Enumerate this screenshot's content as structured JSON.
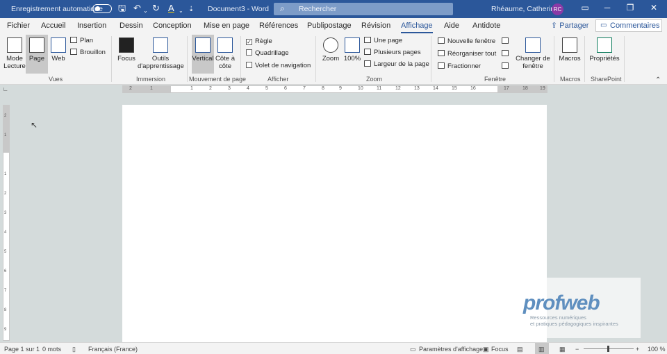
{
  "titlebar": {
    "autosave_label": "Enregistrement automatique",
    "doc_title": "Document3  -  Word",
    "search_placeholder": "Rechercher",
    "user_name": "Rhéaume, Catherine",
    "user_initials": "RC",
    "icons": [
      "save-icon",
      "undo-icon",
      "redo-icon",
      "font-color-icon",
      "minimize-icon",
      "restore-icon",
      "close-icon"
    ]
  },
  "tabs": [
    "Fichier",
    "Accueil",
    "Insertion",
    "Dessin",
    "Conception",
    "Mise en page",
    "Références",
    "Publipostage",
    "Révision",
    "Affichage",
    "Aide",
    "Antidote"
  ],
  "active_tab": "Affichage",
  "share_label": "Partager",
  "comments_label": "Commentaires",
  "ribbon": {
    "vues": {
      "label": "Vues",
      "mode_lecture": "Mode Lecture",
      "page": "Page",
      "web": "Web",
      "plan": "Plan",
      "brouillon": "Brouillon"
    },
    "immersion": {
      "label": "Immersion",
      "focus": "Focus",
      "outils": "Outils d'apprentissage"
    },
    "mouvement": {
      "label": "Mouvement de page",
      "vertical": "Vertical",
      "cote": "Côte à côte"
    },
    "afficher": {
      "label": "Afficher",
      "regle": "Règle",
      "regle_checked": true,
      "quadrillage": "Quadrillage",
      "volet": "Volet de navigation"
    },
    "zoom": {
      "label": "Zoom",
      "zoom": "Zoom",
      "pct": "100%",
      "une_page": "Une page",
      "plusieurs": "Plusieurs pages",
      "largeur": "Largeur de la page"
    },
    "fenetre": {
      "label": "Fenêtre",
      "nouvelle": "Nouvelle fenêtre",
      "reorganiser": "Réorganiser tout",
      "fractionner": "Fractionner",
      "changer": "Changer de fenêtre"
    },
    "macros": {
      "label": "Macros",
      "macros": "Macros"
    },
    "sharepoint": {
      "label": "SharePoint",
      "proprietes": "Propriétés"
    }
  },
  "ruler": {
    "h_ticks": [
      "2",
      "1",
      "1",
      "2",
      "3",
      "4",
      "5",
      "6",
      "7",
      "8",
      "9",
      "10",
      "11",
      "12",
      "13",
      "14",
      "15",
      "16",
      "17",
      "18",
      "19"
    ],
    "v_ticks": [
      "2",
      "1",
      "1",
      "2",
      "3",
      "4",
      "5",
      "6",
      "7",
      "8",
      "9"
    ]
  },
  "logo": {
    "word": "profweb",
    "line1": "Ressources numériques",
    "line2": "et pratiques pédagogiques inspirantes"
  },
  "status": {
    "page": "Page 1 sur 1",
    "words": "0 mots",
    "language": "Français (France)",
    "display_settings": "Paramètres d'affichage",
    "focus": "Focus",
    "zoom_minus": "−",
    "zoom_plus": "+",
    "zoom": "100 %"
  },
  "colors": {
    "brand": "#2b579a",
    "canvas": "#d4dbdb"
  }
}
